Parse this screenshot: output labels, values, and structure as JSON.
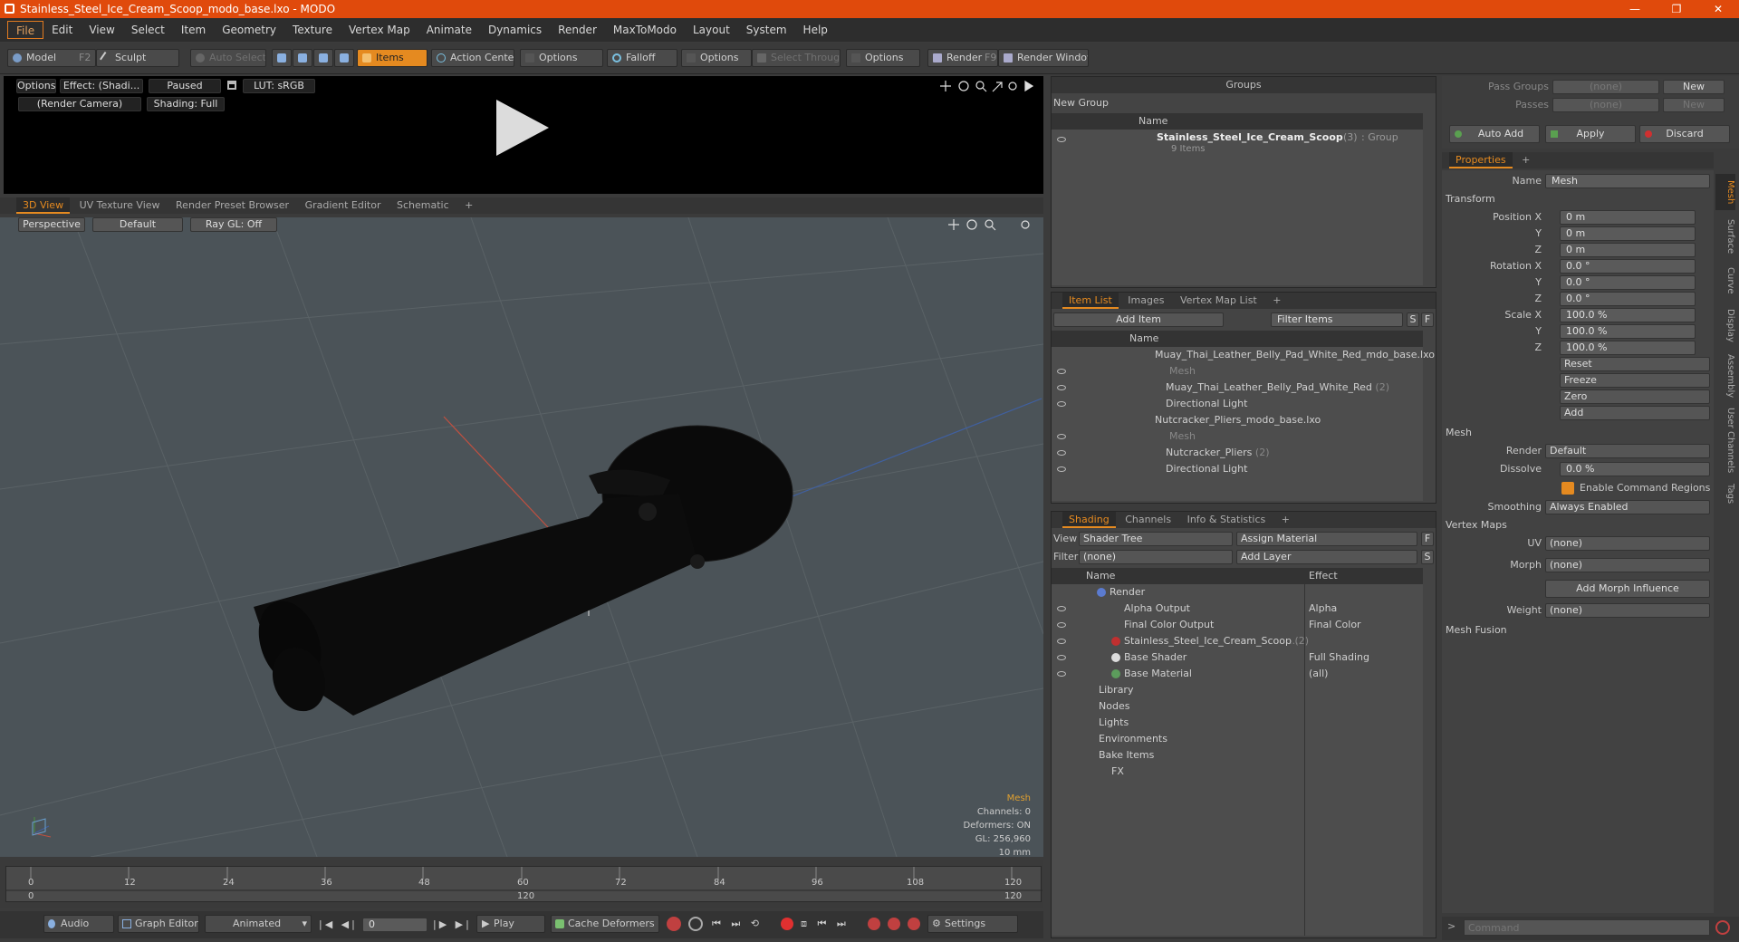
{
  "window": {
    "title": "Stainless_Steel_Ice_Cream_Scoop_modo_base.lxo - MODO",
    "minimize": "—",
    "maximize": "❐",
    "close": "✕"
  },
  "menu": [
    "File",
    "Edit",
    "View",
    "Select",
    "Item",
    "Geometry",
    "Texture",
    "Vertex Map",
    "Animate",
    "Dynamics",
    "Render",
    "MaxToModo",
    "Layout",
    "System",
    "Help"
  ],
  "toolbar": {
    "model": "Model",
    "model_key": "F2",
    "sculpt": "Sculpt",
    "auto_select": "Auto Select",
    "items": "Items",
    "action_center": "Action Center",
    "options1": "Options",
    "falloff": "Falloff",
    "options2": "Options",
    "select_through": "Select Through",
    "options3": "Options",
    "render": "Render",
    "render_key": "F9",
    "render_window": "Render Window"
  },
  "render_preview": {
    "options": "Options",
    "effect": "Effect: (Shadi...",
    "paused": "Paused",
    "lut": "LUT: sRGB",
    "camera": "(Render Camera)",
    "shading": "Shading: Full"
  },
  "viewport_tabs": [
    "3D View",
    "UV Texture View",
    "Render Preset Browser",
    "Gradient Editor",
    "Schematic"
  ],
  "viewport": {
    "perspective": "Perspective",
    "default": "Default",
    "raygl": "Ray GL: Off",
    "info": {
      "mesh": "Mesh",
      "channels": "Channels: 0",
      "deformers": "Deformers: ON",
      "gl": "GL: 256,960",
      "scale": "10 mm"
    }
  },
  "timeline": {
    "ticks": [
      "0",
      "12",
      "24",
      "36",
      "48",
      "60",
      "72",
      "84",
      "96",
      "108",
      "120"
    ],
    "sub_start": "0",
    "sub_mid": "120",
    "sub_end": "120"
  },
  "bottom": {
    "audio": "Audio",
    "graph_editor": "Graph Editor",
    "animated": "Animated",
    "frame": "0",
    "play": "Play",
    "cache": "Cache Deformers",
    "settings": "Settings"
  },
  "groups": {
    "title": "Groups",
    "new_group": "New Group",
    "name_col": "Name",
    "item_name": "Stainless_Steel_Ice_Cream_Scoop",
    "item_count": "(3)",
    "item_type": ": Group",
    "item_sub": "9 Items"
  },
  "item_list": {
    "tabs": [
      "Item List",
      "Images",
      "Vertex Map List"
    ],
    "add_item": "Add Item",
    "filter": "Filter Items",
    "s": "S",
    "f": "F",
    "name_col": "Name",
    "rows": [
      {
        "label": "Muay_Thai_Leather_Belly_Pad_White_Red_mdo_base.lxo",
        "dim": false
      },
      {
        "label": "Mesh",
        "dim": true
      },
      {
        "label": "Muay_Thai_Leather_Belly_Pad_White_Red",
        "count": "(2)",
        "dim": false
      },
      {
        "label": "Directional Light",
        "dim": false
      },
      {
        "label": "Nutcracker_Pliers_modo_base.lxo",
        "dim": false
      },
      {
        "label": "Mesh",
        "dim": true
      },
      {
        "label": "Nutcracker_Pliers",
        "count": "(2)",
        "dim": false
      },
      {
        "label": "Directional Light",
        "dim": false
      }
    ]
  },
  "shading": {
    "tabs": [
      "Shading",
      "Channels",
      "Info & Statistics"
    ],
    "view_lbl": "View",
    "view_val": "Shader Tree",
    "assign": "Assign Material",
    "filter_lbl": "Filter",
    "filter_val": "(none)",
    "add_layer": "Add Layer",
    "f": "F",
    "s": "S",
    "name_col": "Name",
    "effect_col": "Effect",
    "rows": [
      {
        "name": "Render",
        "effect": ""
      },
      {
        "name": "Alpha Output",
        "effect": "Alpha"
      },
      {
        "name": "Final Color Output",
        "effect": "Final Color"
      },
      {
        "name": "Stainless_Steel_Ice_Cream_Scoop",
        "count": "(2)",
        "effect": "..."
      },
      {
        "name": "Base Shader",
        "effect": "Full Shading"
      },
      {
        "name": "Base Material",
        "effect": "(all)"
      },
      {
        "name": "Library",
        "effect": ""
      },
      {
        "name": "Nodes",
        "effect": ""
      },
      {
        "name": "Lights",
        "effect": ""
      },
      {
        "name": "Environments",
        "effect": ""
      },
      {
        "name": "Bake Items",
        "effect": ""
      },
      {
        "name": "FX",
        "effect": ""
      }
    ]
  },
  "passes": {
    "pass_groups": "Pass Groups",
    "passes": "Passes",
    "none1": "(none)",
    "none2": "(none)",
    "new1": "New",
    "new2": "New",
    "auto_add": "Auto Add",
    "apply": "Apply",
    "discard": "Discard"
  },
  "properties": {
    "tab": "Properties",
    "name_lbl": "Name",
    "name_val": "Mesh",
    "transform": "Transform",
    "pos_lbl": "Position X",
    "y": "Y",
    "z": "Z",
    "pos": [
      "0 m",
      "0 m",
      "0 m"
    ],
    "rot_lbl": "Rotation X",
    "rot": [
      "0.0 °",
      "0.0 °",
      "0.0 °"
    ],
    "scale_lbl": "Scale X",
    "scale": [
      "100.0 %",
      "100.0 %",
      "100.0 %"
    ],
    "reset": "Reset",
    "freeze": "Freeze",
    "zero": "Zero",
    "add": "Add",
    "mesh": "Mesh",
    "render_lbl": "Render",
    "render_val": "Default",
    "dissolve_lbl": "Dissolve",
    "dissolve_val": "0.0 %",
    "cmd_regions": "Enable Command Regions",
    "smoothing_lbl": "Smoothing",
    "smoothing_val": "Always Enabled",
    "vertex_maps": "Vertex Maps",
    "uv_lbl": "UV",
    "uv_val": "(none)",
    "morph_lbl": "Morph",
    "morph_val": "(none)",
    "add_morph": "Add Morph Influence",
    "weight_lbl": "Weight",
    "weight_val": "(none)",
    "mesh_fusion": "Mesh Fusion",
    "side_tabs": [
      "Mesh",
      "Surface",
      "Curve",
      "Display",
      "Assembly",
      "User Channels",
      "Tags"
    ]
  },
  "command": {
    "placeholder": "Command"
  }
}
